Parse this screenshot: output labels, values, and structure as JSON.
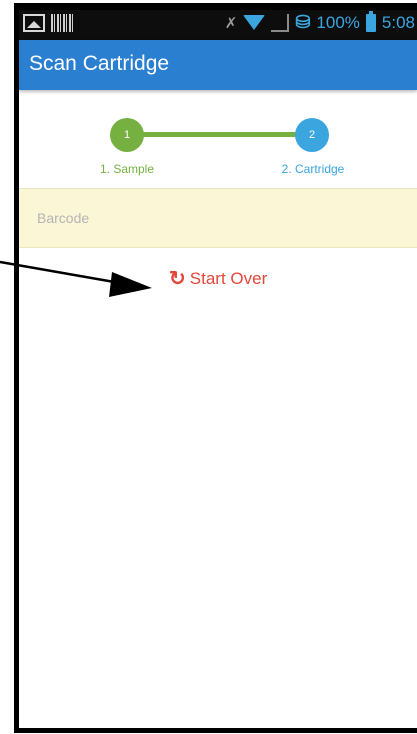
{
  "status_bar": {
    "battery_percent": "100%",
    "time": "5:08",
    "left_icons": [
      "image-icon",
      "barcode-icon"
    ],
    "right_icons": [
      "mute-icon",
      "wifi-icon",
      "signal-icon",
      "network-icon",
      "battery-icon"
    ]
  },
  "app_bar": {
    "title": "Scan Cartridge"
  },
  "stepper": {
    "steps": [
      {
        "number": "1",
        "label": "1. Sample",
        "color": "#76b041"
      },
      {
        "number": "2",
        "label": "2. Cartridge",
        "color": "#3aa5df"
      }
    ],
    "line_color": "#76b041"
  },
  "barcode": {
    "placeholder": "Barcode",
    "value": ""
  },
  "start_over": {
    "icon": "refresh-icon",
    "label": "Start Over",
    "color": "#e2473a"
  },
  "colors": {
    "app_bar": "#2b7fd0",
    "barcode_bg": "#fbf6d6"
  }
}
